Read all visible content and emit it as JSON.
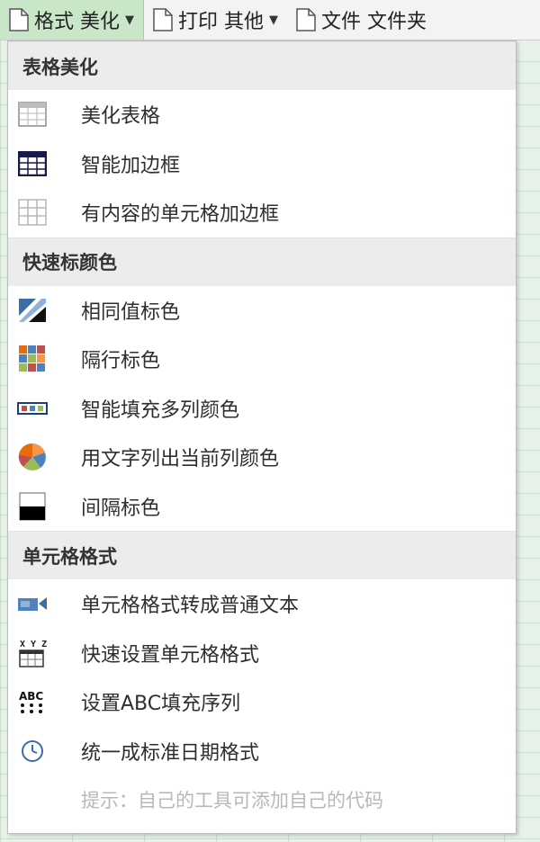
{
  "toolbar": {
    "buttons": [
      {
        "label": "格式 美化",
        "has_caret": true,
        "active": true
      },
      {
        "label": "打印 其他",
        "has_caret": true,
        "active": false
      },
      {
        "label": "文件 文件夹",
        "has_caret": false,
        "active": false
      }
    ]
  },
  "menu": {
    "sections": [
      {
        "title": "表格美化",
        "items": [
          {
            "label": "美化表格",
            "icon": "table-icon"
          },
          {
            "label": "智能加边框",
            "icon": "bordered-table-icon"
          },
          {
            "label": "有内容的单元格加边框",
            "icon": "grid-border-icon"
          }
        ]
      },
      {
        "title": "快速标颜色",
        "items": [
          {
            "label": "相同值标色",
            "icon": "diagonal-color-icon"
          },
          {
            "label": "隔行标色",
            "icon": "color-blocks-icon"
          },
          {
            "label": "智能填充多列颜色",
            "icon": "color-strip-icon"
          },
          {
            "label": "用文字列出当前列颜色",
            "icon": "pie-chart-icon"
          },
          {
            "label": "间隔标色",
            "icon": "half-black-icon"
          }
        ]
      },
      {
        "title": "单元格格式",
        "items": [
          {
            "label": "单元格格式转成普通文本",
            "icon": "video-camera-icon"
          },
          {
            "label": "快速设置单元格格式",
            "icon": "xyz-grid-icon"
          },
          {
            "label": "设置ABC填充序列",
            "icon": "abc-icon"
          },
          {
            "label": "统一成标准日期格式",
            "icon": "clock-icon"
          }
        ]
      }
    ],
    "hint": "提示：自己的工具可添加自己的代码"
  },
  "colors": {
    "toolbar_active": "#c9e6c8",
    "section_bg": "#ececec",
    "hint_text": "#b8b8b8"
  }
}
